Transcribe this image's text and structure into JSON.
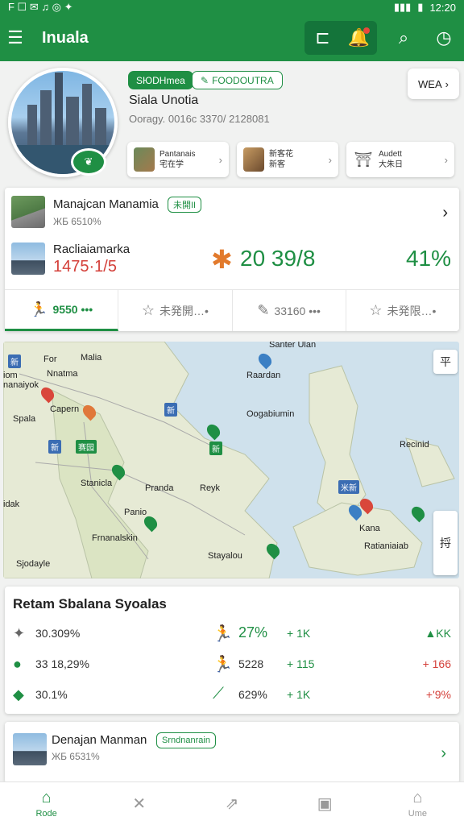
{
  "status_bar": {
    "left_icons": "F ☐ ✉ ♫ ◎ ✦",
    "time": "12:20"
  },
  "app_bar": {
    "title": "Inuala"
  },
  "hero": {
    "pill_primary": "SЮDHmea",
    "pill_secondary": "FOODOUTRA",
    "name": "Siala Unotia",
    "meta": "Ooragy. 0016c 3370/ 2128081",
    "weather_button": "WEA",
    "chips": [
      {
        "line1": "Pantanais",
        "line2": "宅在学"
      },
      {
        "line1": "新客花",
        "line2": "新客"
      },
      {
        "line1": "Audett",
        "line2": "大朱日"
      }
    ]
  },
  "summary_card": {
    "row1_title": "Manajcan Manamia",
    "row1_tag": "未開II",
    "row1_sub": "ЖБ 6510%",
    "row2_title": "Racliaiamarka",
    "row2_value": "1475·1/5",
    "row2_big": "20 39/8",
    "row2_pct": "41%",
    "stats": [
      {
        "label": "9550 •••",
        "icon": "runner-icon"
      },
      {
        "label": "未発開…•",
        "icon": "star-icon"
      },
      {
        "label": "33160 •••",
        "icon": "pen-icon"
      },
      {
        "label": "未発限…•",
        "icon": "star-icon"
      }
    ]
  },
  "map": {
    "labels": [
      {
        "text": "Santer Ulan"
      },
      {
        "text": "For"
      },
      {
        "text": "Malia"
      },
      {
        "text": "iom"
      },
      {
        "text": "Nnatma"
      },
      {
        "text": "nanaiyok"
      },
      {
        "text": "Raardan"
      },
      {
        "text": "Capern"
      },
      {
        "text": "Spala"
      },
      {
        "text": "Oogabiumin"
      },
      {
        "text": "Recinid"
      },
      {
        "text": "Stanicla"
      },
      {
        "text": "Pranda"
      },
      {
        "text": "Reyk"
      },
      {
        "text": "idak"
      },
      {
        "text": "Panio"
      },
      {
        "text": "Frnanalskin"
      },
      {
        "text": "Kana"
      },
      {
        "text": "Sjodayle"
      },
      {
        "text": "Stayalou"
      },
      {
        "text": "Ratianiaiab"
      }
    ],
    "tags": [
      "新",
      "新",
      "赛园",
      "新",
      "米新",
      "新"
    ],
    "layer_button": "平",
    "side_button": "捋"
  },
  "trend_card": {
    "heading": "Retam Sbalana Syoalas",
    "rows": [
      {
        "c1": "30.309%",
        "c2": "27%",
        "c3": "+ 1K",
        "c4": "▲KK"
      },
      {
        "c1": "33 18,29%",
        "c2": "5228",
        "c3": "+ 115",
        "c4": "+ 166"
      },
      {
        "c1": "30.1%",
        "c2": "629%",
        "c3": "+ 1K",
        "c4": "+'9%"
      }
    ]
  },
  "footer_card": {
    "title": "Denajan Manman",
    "tag": "Srndnanrain",
    "sub": "ЖБ 6531%"
  },
  "bottom_nav": [
    {
      "label": "Rode",
      "icon": "home-icon"
    },
    {
      "label": "",
      "icon": "close-icon"
    },
    {
      "label": "",
      "icon": "share-icon"
    },
    {
      "label": "",
      "icon": "square-icon"
    },
    {
      "label": "Ume",
      "icon": "house-icon"
    }
  ],
  "colors": {
    "primary": "#1f8f44",
    "negative": "#d4403a",
    "accent": "#e27a2c"
  }
}
